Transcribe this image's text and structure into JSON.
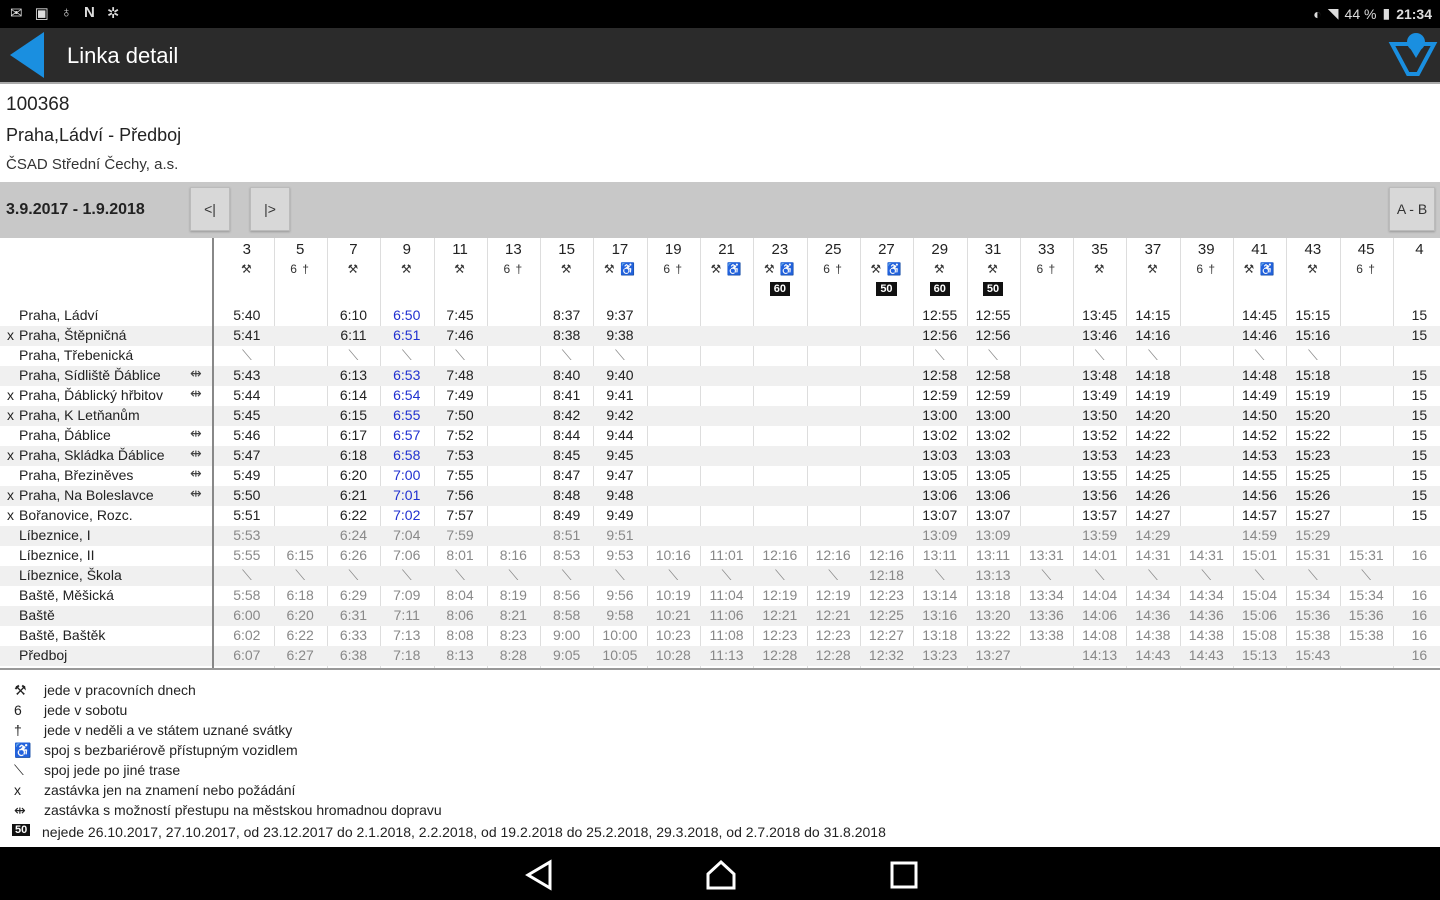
{
  "status": {
    "left_icons": [
      "mail-icon",
      "photo-icon",
      "bulb-icon",
      "n-icon",
      "grid-icon"
    ],
    "battery": "44 %",
    "time": "21:34"
  },
  "actionbar": {
    "title": "Linka detail",
    "back_icon": "back-arrow-icon",
    "right_icon": "filter-icon",
    "accent": "#1a8fe0"
  },
  "line": {
    "number": "100368",
    "route": "Praha,Ládví - Předboj",
    "operator": "ČSAD Střední Čechy, a.s."
  },
  "datebar": {
    "range": "3.9.2017 - 1.9.2018",
    "prev": "<|",
    "next": "|>",
    "direction": "A - B"
  },
  "columns": [
    {
      "num": "3",
      "sym": "⚒",
      "note": ""
    },
    {
      "num": "5",
      "sym": "6 †",
      "note": ""
    },
    {
      "num": "7",
      "sym": "⚒",
      "note": ""
    },
    {
      "num": "9",
      "sym": "⚒",
      "note": ""
    },
    {
      "num": "11",
      "sym": "⚒",
      "note": ""
    },
    {
      "num": "13",
      "sym": "6 †",
      "note": ""
    },
    {
      "num": "15",
      "sym": "⚒",
      "note": ""
    },
    {
      "num": "17",
      "sym": "⚒ ♿",
      "note": ""
    },
    {
      "num": "19",
      "sym": "6 †",
      "note": ""
    },
    {
      "num": "21",
      "sym": "⚒ ♿",
      "note": ""
    },
    {
      "num": "23",
      "sym": "⚒ ♿",
      "note": "60"
    },
    {
      "num": "25",
      "sym": "6 †",
      "note": ""
    },
    {
      "num": "27",
      "sym": "⚒ ♿",
      "note": "50"
    },
    {
      "num": "29",
      "sym": "⚒",
      "note": "60"
    },
    {
      "num": "31",
      "sym": "⚒",
      "note": "50"
    },
    {
      "num": "33",
      "sym": "6 †",
      "note": ""
    },
    {
      "num": "35",
      "sym": "⚒",
      "note": ""
    },
    {
      "num": "37",
      "sym": "⚒",
      "note": ""
    },
    {
      "num": "39",
      "sym": "6 †",
      "note": ""
    },
    {
      "num": "41",
      "sym": "⚒ ♿",
      "note": ""
    },
    {
      "num": "43",
      "sym": "⚒",
      "note": ""
    },
    {
      "num": "45",
      "sym": "6 †",
      "note": ""
    },
    {
      "num": "4",
      "sym": "",
      "note": ""
    }
  ],
  "stops": [
    {
      "x": "",
      "name": "Praha, Ládví",
      "tr": "",
      "style": "n",
      "times": [
        "5:40",
        "",
        "6:10",
        "6:50",
        "7:45",
        "",
        "8:37",
        "9:37",
        "",
        "",
        "",
        "",
        "",
        "12:55",
        "12:55",
        "",
        "13:45",
        "14:15",
        "",
        "14:45",
        "15:15",
        "",
        "15"
      ]
    },
    {
      "x": "x",
      "name": "Praha, Štěpničná",
      "tr": "",
      "style": "n",
      "times": [
        "5:41",
        "",
        "6:11",
        "6:51",
        "7:46",
        "",
        "8:38",
        "9:38",
        "",
        "",
        "",
        "",
        "",
        "12:56",
        "12:56",
        "",
        "13:46",
        "14:16",
        "",
        "14:46",
        "15:16",
        "",
        "15"
      ]
    },
    {
      "x": "",
      "name": "Praha, Třebenická",
      "tr": "",
      "style": "n",
      "times": [
        "⟍",
        "",
        "⟍",
        "⟍",
        "⟍",
        "",
        "⟍",
        "⟍",
        "",
        "",
        "",
        "",
        "",
        "⟍",
        "⟍",
        "",
        "⟍",
        "⟍",
        "",
        "⟍",
        "⟍",
        "",
        ""
      ]
    },
    {
      "x": "",
      "name": "Praha, Sídliště Ďáblice",
      "tr": "⇹",
      "style": "n",
      "times": [
        "5:43",
        "",
        "6:13",
        "6:53",
        "7:48",
        "",
        "8:40",
        "9:40",
        "",
        "",
        "",
        "",
        "",
        "12:58",
        "12:58",
        "",
        "13:48",
        "14:18",
        "",
        "14:48",
        "15:18",
        "",
        "15"
      ]
    },
    {
      "x": "x",
      "name": "Praha, Ďáblický hřbitov",
      "tr": "⇹",
      "style": "n",
      "times": [
        "5:44",
        "",
        "6:14",
        "6:54",
        "7:49",
        "",
        "8:41",
        "9:41",
        "",
        "",
        "",
        "",
        "",
        "12:59",
        "12:59",
        "",
        "13:49",
        "14:19",
        "",
        "14:49",
        "15:19",
        "",
        "15"
      ]
    },
    {
      "x": "x",
      "name": "Praha, K Letňanům",
      "tr": "",
      "style": "n",
      "times": [
        "5:45",
        "",
        "6:15",
        "6:55",
        "7:50",
        "",
        "8:42",
        "9:42",
        "",
        "",
        "",
        "",
        "",
        "13:00",
        "13:00",
        "",
        "13:50",
        "14:20",
        "",
        "14:50",
        "15:20",
        "",
        "15"
      ]
    },
    {
      "x": "",
      "name": "Praha, Ďáblice",
      "tr": "⇹",
      "style": "n",
      "times": [
        "5:46",
        "",
        "6:17",
        "6:57",
        "7:52",
        "",
        "8:44",
        "9:44",
        "",
        "",
        "",
        "",
        "",
        "13:02",
        "13:02",
        "",
        "13:52",
        "14:22",
        "",
        "14:52",
        "15:22",
        "",
        "15"
      ]
    },
    {
      "x": "x",
      "name": "Praha, Skládka Ďáblice",
      "tr": "⇹",
      "style": "n",
      "times": [
        "5:47",
        "",
        "6:18",
        "6:58",
        "7:53",
        "",
        "8:45",
        "9:45",
        "",
        "",
        "",
        "",
        "",
        "13:03",
        "13:03",
        "",
        "13:53",
        "14:23",
        "",
        "14:53",
        "15:23",
        "",
        "15"
      ]
    },
    {
      "x": "",
      "name": "Praha, Březiněves",
      "tr": "⇹",
      "style": "n",
      "times": [
        "5:49",
        "",
        "6:20",
        "7:00",
        "7:55",
        "",
        "8:47",
        "9:47",
        "",
        "",
        "",
        "",
        "",
        "13:05",
        "13:05",
        "",
        "13:55",
        "14:25",
        "",
        "14:55",
        "15:25",
        "",
        "15"
      ]
    },
    {
      "x": "x",
      "name": "Praha, Na Boleslavce",
      "tr": "⇹",
      "style": "n",
      "times": [
        "5:50",
        "",
        "6:21",
        "7:01",
        "7:56",
        "",
        "8:48",
        "9:48",
        "",
        "",
        "",
        "",
        "",
        "13:06",
        "13:06",
        "",
        "13:56",
        "14:26",
        "",
        "14:56",
        "15:26",
        "",
        "15"
      ]
    },
    {
      "x": "x",
      "name": "Bořanovice, Rozc.",
      "tr": "",
      "style": "n",
      "times": [
        "5:51",
        "",
        "6:22",
        "7:02",
        "7:57",
        "",
        "8:49",
        "9:49",
        "",
        "",
        "",
        "",
        "",
        "13:07",
        "13:07",
        "",
        "13:57",
        "14:27",
        "",
        "14:57",
        "15:27",
        "",
        "15"
      ]
    },
    {
      "x": "",
      "name": "Líbeznice, I",
      "tr": "",
      "style": "g",
      "times": [
        "5:53",
        "",
        "6:24",
        "7:04",
        "7:59",
        "",
        "8:51",
        "9:51",
        "",
        "",
        "",
        "",
        "",
        "13:09",
        "13:09",
        "",
        "13:59",
        "14:29",
        "",
        "14:59",
        "15:29",
        "",
        ""
      ]
    },
    {
      "x": "",
      "name": "Líbeznice, II",
      "tr": "",
      "style": "g",
      "times": [
        "5:55",
        "6:15",
        "6:26",
        "7:06",
        "8:01",
        "8:16",
        "8:53",
        "9:53",
        "10:16",
        "11:01",
        "12:16",
        "12:16",
        "12:16",
        "13:11",
        "13:11",
        "13:31",
        "14:01",
        "14:31",
        "14:31",
        "15:01",
        "15:31",
        "15:31",
        "16"
      ]
    },
    {
      "x": "",
      "name": "Líbeznice, Škola",
      "tr": "",
      "style": "g",
      "times": [
        "⟍",
        "⟍",
        "⟍",
        "⟍",
        "⟍",
        "⟍",
        "⟍",
        "⟍",
        "⟍",
        "⟍",
        "⟍",
        "⟍",
        "12:18",
        "⟍",
        "13:13",
        "⟍",
        "⟍",
        "⟍",
        "⟍",
        "⟍",
        "⟍",
        "⟍",
        ""
      ]
    },
    {
      "x": "",
      "name": "Baště, Měšická",
      "tr": "",
      "style": "g",
      "times": [
        "5:58",
        "6:18",
        "6:29",
        "7:09",
        "8:04",
        "8:19",
        "8:56",
        "9:56",
        "10:19",
        "11:04",
        "12:19",
        "12:19",
        "12:23",
        "13:14",
        "13:18",
        "13:34",
        "14:04",
        "14:34",
        "14:34",
        "15:04",
        "15:34",
        "15:34",
        "16"
      ]
    },
    {
      "x": "",
      "name": "Baště",
      "tr": "",
      "style": "g",
      "times": [
        "6:00",
        "6:20",
        "6:31",
        "7:11",
        "8:06",
        "8:21",
        "8:58",
        "9:58",
        "10:21",
        "11:06",
        "12:21",
        "12:21",
        "12:25",
        "13:16",
        "13:20",
        "13:36",
        "14:06",
        "14:36",
        "14:36",
        "15:06",
        "15:36",
        "15:36",
        "16"
      ]
    },
    {
      "x": "",
      "name": "Baště, Baštěk",
      "tr": "",
      "style": "g",
      "times": [
        "6:02",
        "6:22",
        "6:33",
        "7:13",
        "8:08",
        "8:23",
        "9:00",
        "10:00",
        "10:23",
        "11:08",
        "12:23",
        "12:23",
        "12:27",
        "13:18",
        "13:22",
        "13:38",
        "14:08",
        "14:38",
        "14:38",
        "15:08",
        "15:38",
        "15:38",
        "16"
      ]
    },
    {
      "x": "",
      "name": "Předboj",
      "tr": "",
      "style": "g",
      "times": [
        "6:07",
        "6:27",
        "6:38",
        "7:18",
        "8:13",
        "8:28",
        "9:05",
        "10:05",
        "10:28",
        "11:13",
        "12:28",
        "12:28",
        "12:32",
        "13:23",
        "13:27",
        "",
        "14:13",
        "14:43",
        "14:43",
        "15:13",
        "15:43",
        "",
        "16"
      ]
    }
  ],
  "blue_column": 3,
  "legend": [
    {
      "sym": "⚒",
      "text": "jede v pracovních dnech"
    },
    {
      "sym": "6",
      "text": "jede v sobotu"
    },
    {
      "sym": "†",
      "text": "jede v neděli a ve státem uznané svátky"
    },
    {
      "sym": "♿",
      "text": "spoj s bezbariérově přístupným vozidlem"
    },
    {
      "sym": "⟍",
      "text": "spoj jede po jiné trase"
    },
    {
      "sym": "x",
      "text": "zastávka jen na znamení nebo požádání"
    },
    {
      "sym": "⇹",
      "text": "zastávka s možností přestupu na městskou hromadnou dopravu"
    }
  ],
  "legend_note": {
    "box": "50",
    "text": "nejede 26.10.2017, 27.10.2017, od 23.12.2017 do 2.1.2018, 2.2.2018, od 19.2.2018 do 25.2.2018, 29.3.2018, od 2.7.2018 do 31.8.2018"
  },
  "nav": {
    "back": "back-triangle-icon",
    "home": "home-icon",
    "recent": "recent-apps-icon"
  }
}
